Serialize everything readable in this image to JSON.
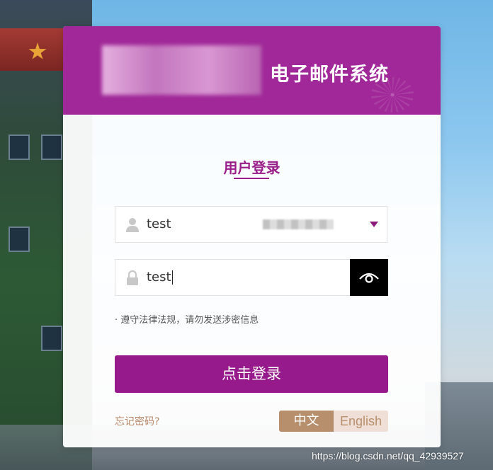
{
  "header": {
    "title": "电子邮件系统"
  },
  "login": {
    "section_title": "用户登录",
    "username_value": "test",
    "password_value": "test",
    "notice": "· 遵守法律法规，请勿发送涉密信息",
    "submit_label": "点击登录",
    "forgot_label": "忘记密码?"
  },
  "language": {
    "zh_label": "中文",
    "en_label": "English",
    "selected": "中文"
  },
  "watermark": "https://blog.csdn.net/qq_42939527",
  "icons": {
    "user": "user-icon",
    "lock": "lock-icon",
    "eye": "eye-icon",
    "dropdown": "triangle-down-icon"
  },
  "colors": {
    "brand": "#a02898",
    "button": "#961a8b",
    "accent_gold": "#b78f6c"
  }
}
